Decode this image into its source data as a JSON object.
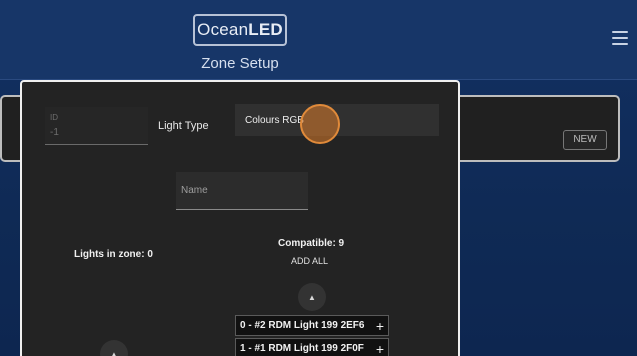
{
  "header": {
    "logo_regular": "Ocean",
    "logo_bold": "LED",
    "title": "Zone Setup"
  },
  "background": {
    "new_button": "NEW"
  },
  "modal": {
    "id_field": {
      "label": "ID",
      "value": "-1"
    },
    "light_type_label": "Light Type",
    "light_type_value": "Colours RGB",
    "name_field": {
      "placeholder": "Name"
    },
    "lights_in_zone": "Lights in zone: 0",
    "compatible": "Compatible: 9",
    "add_all": "ADD ALL",
    "up_arrow": "▲",
    "compatible_lights": [
      {
        "label": "0 - #2 RDM Light 199 2EF6",
        "action": "+"
      },
      {
        "label": "1 - #1 RDM Light 199 2F0F",
        "action": "+"
      }
    ]
  },
  "colors": {
    "header_bg": "#173668",
    "modal_bg": "#232323",
    "touch_indicator": "#e08a3a"
  },
  "icons": {
    "menu": "hamburger-icon",
    "up": "chevron-up-icon",
    "add": "plus-icon"
  }
}
